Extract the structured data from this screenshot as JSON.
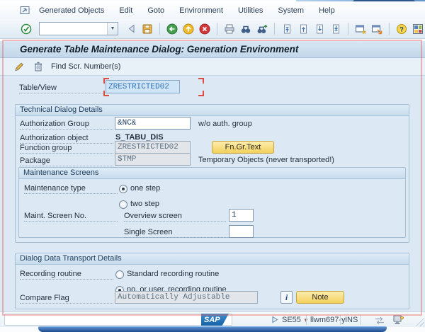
{
  "window": {
    "minimize": "minimize",
    "maximize": "maximize",
    "close": "close"
  },
  "menu": {
    "items": [
      "Generated Objects",
      "Edit",
      "Goto",
      "Environment",
      "Utilities",
      "System",
      "Help"
    ]
  },
  "toolbar": {
    "command_value": "",
    "icons": [
      "enter-icon",
      "command-field",
      "command-expand-icon",
      "save-icon",
      "back-icon",
      "exit-icon",
      "cancel-icon",
      "print-icon",
      "find-icon",
      "find-next-icon",
      "first-page-icon",
      "previous-page-icon",
      "next-page-icon",
      "last-page-icon",
      "new-session-icon",
      "create-shortcut-icon",
      "help-icon",
      "customize-layout-icon"
    ]
  },
  "header": {
    "title": "Generate Table Maintenance Dialog: Generation Environment"
  },
  "app_toolbar": {
    "find_label": "Find Scr. Number(s)"
  },
  "form": {
    "table_view": {
      "label": "Table/View",
      "value": "ZRESTRICTED02"
    },
    "technical": {
      "title": "Technical Dialog Details",
      "auth_group_label": "Authorization Group",
      "auth_group_value": "&NC&",
      "auth_group_hint": "w/o auth. group",
      "auth_object_label": "Authorization object",
      "auth_object_value": "S_TABU_DIS",
      "function_group_label": "Function group",
      "function_group_value": "ZRESTRICTED02",
      "fn_gr_text_button": "Fn.Gr.Text",
      "package_label": "Package",
      "package_value": "$TMP",
      "package_hint": "Temporary Objects (never transported!)"
    },
    "maintenance": {
      "title": "Maintenance Screens",
      "type_label": "Maintenance type",
      "one_step": "one step",
      "two_step": "two step",
      "screen_no_label": "Maint. Screen No.",
      "overview_label": "Overview screen",
      "overview_value": "1",
      "single_label": "Single Screen",
      "single_value": ""
    },
    "transport": {
      "title": "Dialog Data Transport Details",
      "recording_label": "Recording routine",
      "standard_option": "Standard recording routine",
      "no_user_option": "no, or user, recording routine",
      "compare_label": "Compare Flag",
      "compare_value": "Automatically Adjustable",
      "note_button": "Note"
    }
  },
  "statusbar": {
    "logo": "SAP",
    "transaction": "SE55",
    "host": "llwm697-y",
    "mode": "INS"
  }
}
